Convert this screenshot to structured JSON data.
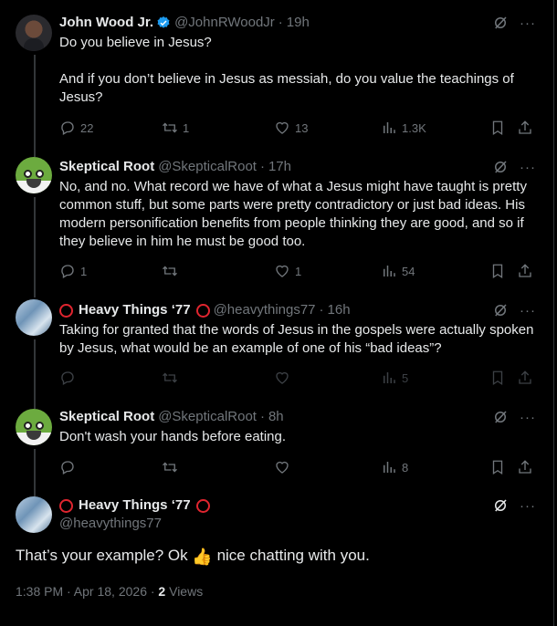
{
  "thread": [
    {
      "name": "John Wood Jr.",
      "verified": true,
      "handle": "@JohnRWoodJr",
      "time": "19h",
      "paragraphs": [
        "Do you believe in Jesus?",
        "And if you don’t believe in Jesus as messiah, do you value the teachings of Jesus?"
      ],
      "replies": "22",
      "reposts": "1",
      "likes": "13",
      "views": "1.3K"
    },
    {
      "name": "Skeptical Root",
      "handle": "@SkepticalRoot",
      "time": "17h",
      "paragraphs": [
        "No, and no.   What record we have of what a Jesus might have taught is pretty common stuff, but some parts were pretty contradictory or just bad ideas.  His modern personification benefits from people thinking they are good, and so if they believe in him he must be good too."
      ],
      "replies": "1",
      "reposts": "",
      "likes": "1",
      "views": "54"
    },
    {
      "name": "Heavy Things ‘77",
      "handle": "@heavythings77",
      "time": "16h",
      "paragraphs": [
        "Taking for granted that the words of Jesus in the gospels were actually spoken by Jesus, what would be an example of one of his “bad ideas”?"
      ],
      "replies": "",
      "reposts": "",
      "likes": "",
      "views": "5"
    },
    {
      "name": "Skeptical Root",
      "handle": "@SkepticalRoot",
      "time": "8h",
      "paragraphs": [
        "Don't wash your hands before eating."
      ],
      "replies": "",
      "reposts": "",
      "likes": "",
      "views": "8"
    }
  ],
  "focused": {
    "name": "Heavy Things ‘77",
    "handle": "@heavythings77",
    "text_before": "That’s your example? Ok",
    "text_after": "nice chatting with you.",
    "timestamp": "1:38 PM · Apr 18, 2026 ·",
    "views_count": "2",
    "views_label": "Views"
  },
  "separator_dot": "·",
  "more_label": "···",
  "colors": {
    "background": "#000000",
    "text": "#e7e9ea",
    "muted": "#71767b",
    "verified": "#1d9bf0",
    "ring": "#e0252f"
  },
  "icons": [
    "grok-icon",
    "more-icon",
    "reply-icon",
    "repost-icon",
    "like-icon",
    "views-icon",
    "bookmark-icon",
    "share-icon",
    "verified-badge-icon",
    "thumbs-up-emoji"
  ]
}
